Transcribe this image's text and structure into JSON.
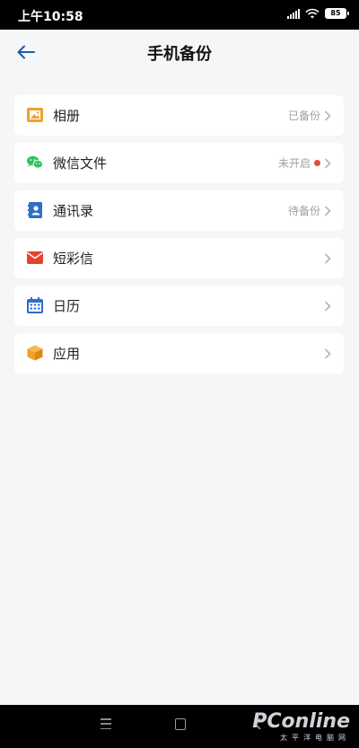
{
  "status_bar": {
    "time": "上午10:58",
    "battery": "85"
  },
  "header": {
    "title": "手机备份"
  },
  "items": [
    {
      "label": "相册",
      "status": "已备份",
      "icon": "photo-album-icon",
      "color": "#f0a12a"
    },
    {
      "label": "微信文件",
      "status": "未开启",
      "icon": "wechat-icon",
      "color": "#2fc15d",
      "dot": true
    },
    {
      "label": "通讯录",
      "status": "待备份",
      "icon": "contacts-icon",
      "color": "#2e6fc8"
    },
    {
      "label": "短彩信",
      "status": "",
      "icon": "message-icon",
      "color": "#e2432f"
    },
    {
      "label": "日历",
      "status": "",
      "icon": "calendar-icon",
      "color": "#2e6fc8"
    },
    {
      "label": "应用",
      "status": "",
      "icon": "app-box-icon",
      "color": "#f0a12a"
    }
  ],
  "watermark": {
    "brand": "PConline",
    "tagline": "太平洋电脑网"
  },
  "colors": {
    "accent": "#1f5aa6",
    "notify_dot": "#e5483f",
    "background": "#f5f6f8"
  }
}
